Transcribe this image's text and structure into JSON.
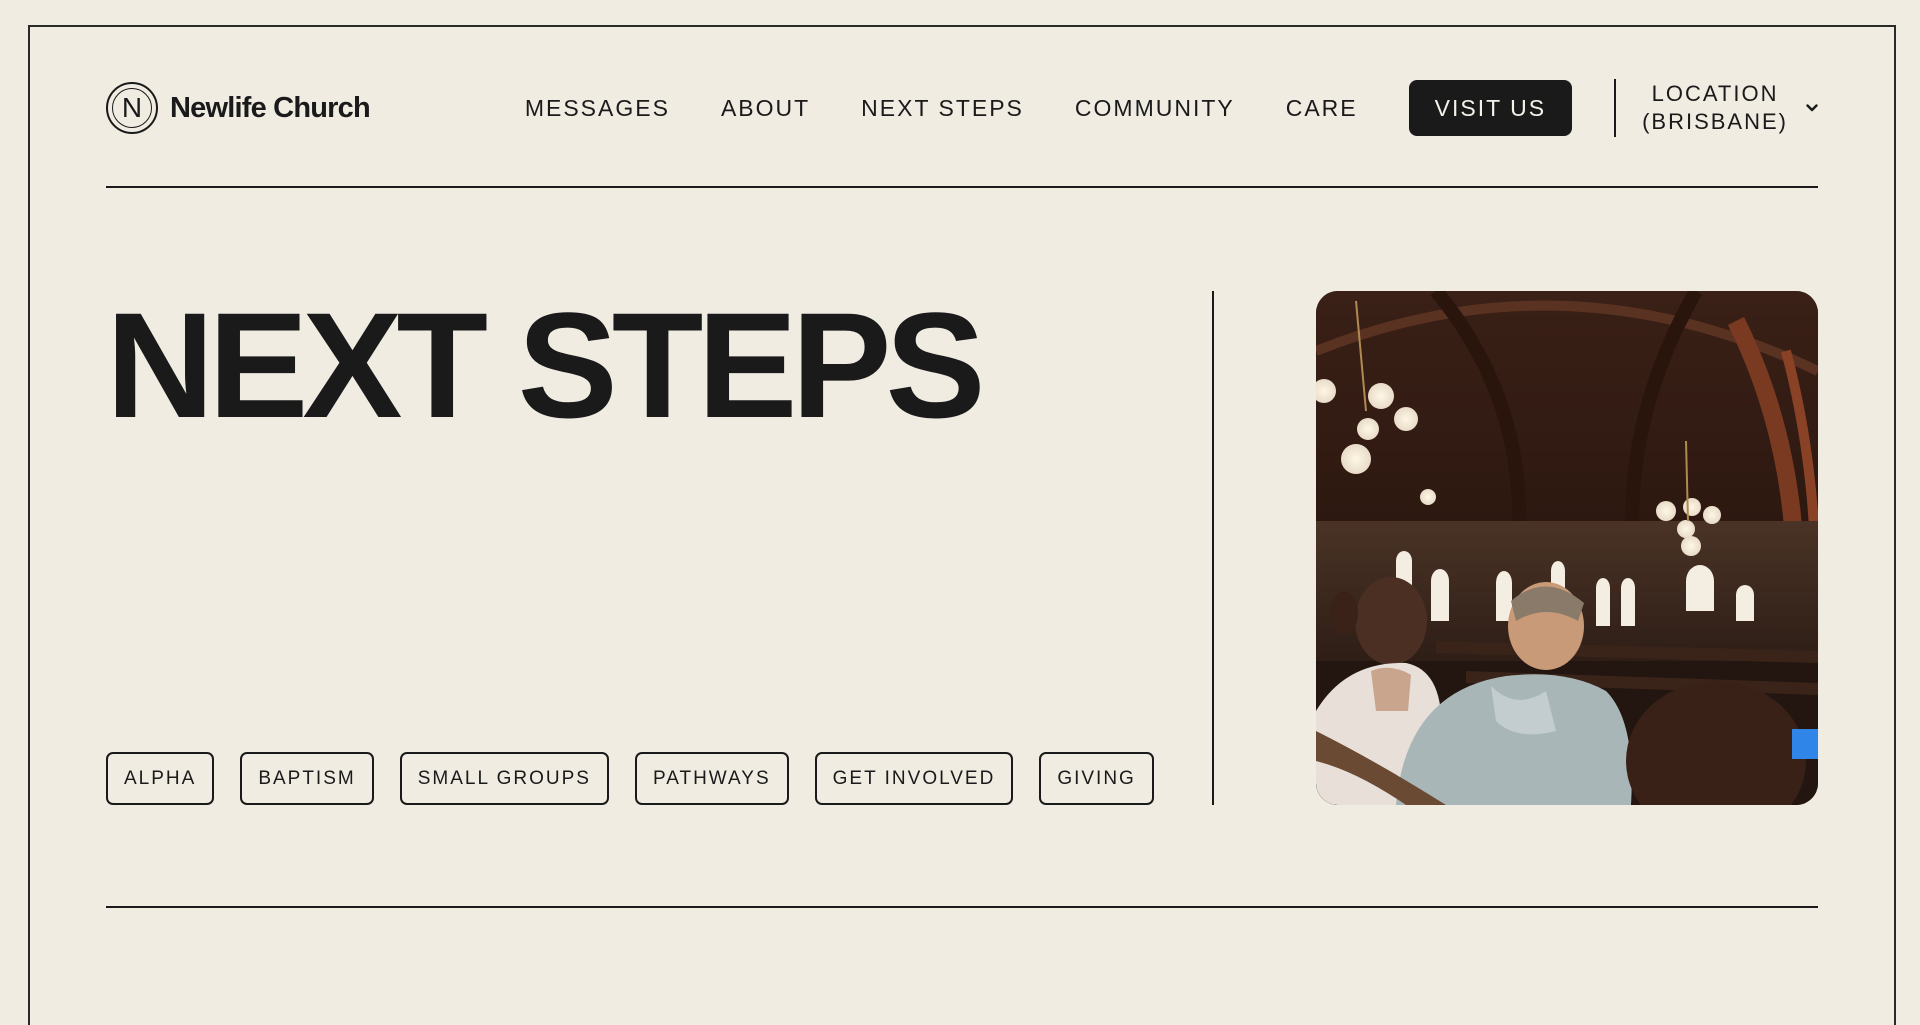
{
  "brand": {
    "logo_letter": "N",
    "name": "Newlife Church"
  },
  "nav": {
    "items": [
      {
        "label": "MESSAGES"
      },
      {
        "label": "ABOUT"
      },
      {
        "label": "NEXT STEPS"
      },
      {
        "label": "COMMUNITY"
      },
      {
        "label": "CARE"
      }
    ],
    "cta_label": "VISIT US",
    "location_line1": "LOCATION",
    "location_line2": "(BRISBANE)"
  },
  "hero": {
    "title": "NEXT STEPS",
    "tags": [
      {
        "label": "ALPHA"
      },
      {
        "label": "BAPTISM"
      },
      {
        "label": "SMALL GROUPS"
      },
      {
        "label": "PATHWAYS"
      },
      {
        "label": "GET INVOLVED"
      },
      {
        "label": "GIVING"
      }
    ]
  },
  "colors": {
    "background": "#f0ece2",
    "ink": "#1a1a1a",
    "button_text": "#f5f2ea"
  }
}
